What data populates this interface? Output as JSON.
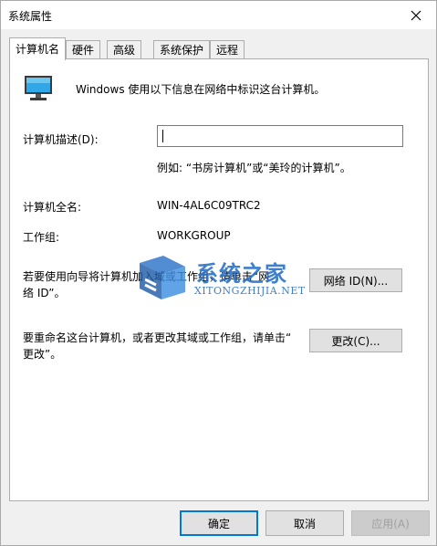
{
  "window": {
    "title": "系统属性"
  },
  "tabs": [
    {
      "label": "计算机名",
      "active": true
    },
    {
      "label": "硬件",
      "active": false
    },
    {
      "label": "高级",
      "active": false
    },
    {
      "label": "系统保护",
      "active": false
    },
    {
      "label": "远程",
      "active": false
    }
  ],
  "panel": {
    "intro": "Windows 使用以下信息在网络中标识这台计算机。",
    "description_label": "计算机描述(D):",
    "description_value": "",
    "example": "例如: “书房计算机”或“美玲的计算机”。",
    "full_name_label": "计算机全名:",
    "full_name_value": "WIN-4AL6C09TRC2",
    "workgroup_label": "工作组:",
    "workgroup_value": "WORKGROUP",
    "network_text_line1": "若要使用向导将计算机加入域或工作组，请单击“网",
    "network_text_line2": "络 ID”。",
    "network_button": "网络 ID(N)...",
    "rename_text_line1": "要重命名这台计算机，或者更改其域或工作组，请单击“",
    "rename_text_line2": "更改”。",
    "change_button": "更改(C)..."
  },
  "footer": {
    "ok": "确定",
    "cancel": "取消",
    "apply": "应用(A)"
  },
  "watermark": {
    "brand": "系统之家",
    "url": "XITONGZHIJIA.NET"
  },
  "colors": {
    "accent": "#0078d7",
    "watermark_blue": "#2a72c9"
  }
}
